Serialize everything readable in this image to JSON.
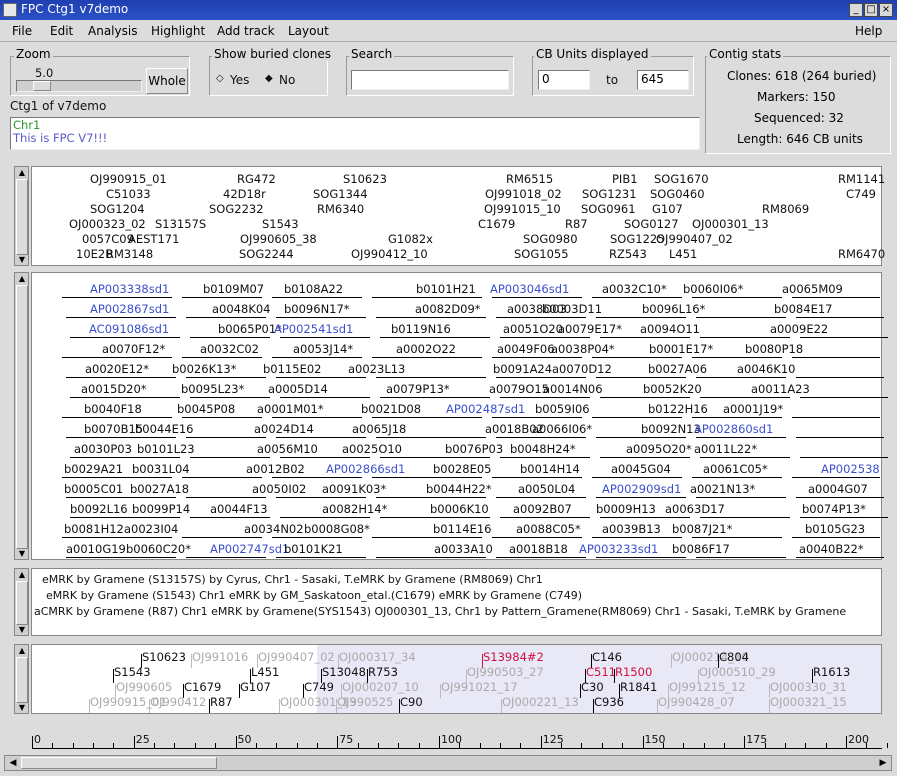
{
  "window": {
    "title": "FPC Ctg1 v7demo"
  },
  "menu": [
    "File",
    "Edit",
    "Analysis",
    "Highlight",
    "Add track",
    "Layout"
  ],
  "help": "Help",
  "zoom": {
    "label": "Zoom",
    "value": "5.0",
    "button": "Whole"
  },
  "buried": {
    "label": "Show buried clones",
    "yes": "Yes",
    "no": "No"
  },
  "search": {
    "label": "Search",
    "value": ""
  },
  "cb": {
    "label": "CB Units displayed",
    "from": "0",
    "to_label": "to",
    "to": "645"
  },
  "stats": {
    "label": "Contig stats",
    "clones": "Clones: 618 (264 buried)",
    "markers": "Markers: 150",
    "sequenced": "Sequenced: 32",
    "length": "Length: 646 CB units"
  },
  "contig": {
    "label": "Ctg1 of v7demo",
    "line1": "Chr1",
    "line2": "This is FPC V7!!!"
  },
  "markers": [
    "OJ990915_01",
    "RG472",
    "S10623",
    "RM6515",
    "PIB1",
    "SOG1670",
    "RM1141",
    "C51033",
    "42D18r",
    "SOG1344",
    "OJ991018_02",
    "SOG1231",
    "SOG0460",
    "C749",
    "SOG1204",
    "SOG2232",
    "RM6340",
    "OJ991015_10",
    "SOG0961",
    "G107",
    "RM8069",
    "OJ000323_02",
    "S13157S",
    "S1543",
    "C1679",
    "R87",
    "SOG0127",
    "OJ000301_13",
    "0057C09",
    "AEST171",
    "OJ990605_38",
    "G1082x",
    "SOG0980",
    "SOG1225",
    "OJ990407_02",
    "10E2B",
    "RM3148",
    "SOG2244",
    "OJ990412_10",
    "SOG1055",
    "RZ543",
    "L451",
    "RM6470"
  ],
  "clones": [
    "AP003338sd1",
    "b0109M07",
    "b0108A22",
    "b0101H21",
    "AP003046sd1",
    "a0032C10*",
    "b0060I06*",
    "a0065M09",
    "AP002867sd1",
    "a0048K04",
    "b0096N17*",
    "a0082D09*",
    "a0038D03",
    "b0003D11",
    "b0096L16*",
    "b0084E17",
    "AC091086sd1",
    "b0065P01*",
    "AP002541sd1",
    "b0119N16",
    "a0051O20",
    "a0079E17*",
    "a0094O11",
    "a0009E22",
    "a0070F12*",
    "a0032C02",
    "a0053J14*",
    "a0002O22",
    "a0049F06",
    "a0038P04*",
    "b0001E17*",
    "b0080P18",
    "a0020E12*",
    "b0026K13*",
    "b0115E02",
    "a0023L13",
    "b0091A24",
    "a0070D12",
    "b0027A06",
    "a0046K10",
    "a0015D20*",
    "b0095L23*",
    "a0005D14",
    "a0079P13*",
    "a0079O15",
    "a0014N06",
    "b0052K20",
    "a0011A23",
    "b0040F18",
    "b0045P08",
    "a0001M01*",
    "b0021D08",
    "AP002487sd1",
    "b0059I06",
    "b0122H16",
    "a0001J19*",
    "b0070B15",
    "b0044E16",
    "a0024D14",
    "a0065J18",
    "a0018B02",
    "a0066I06*",
    "b0092N13",
    "AP002860sd1",
    "a0030P03",
    "b0101L23",
    "a0056M10",
    "a0025O10",
    "b0076P03",
    "b0048H24*",
    "a0095O20*",
    "a0011L22*",
    "b0029A21",
    "b0031L04",
    "a0012B02",
    "AP002866sd1",
    "b0028E05",
    "b0014H14",
    "a0045G04",
    "a0061C05*",
    "AP002538",
    "b0005C01",
    "b0027A18",
    "a0050I02",
    "a0091K03*",
    "b0044H22*",
    "a0050L04",
    "AP002909sd1",
    "a0021N13*",
    "a0004G07",
    "b0092L16",
    "b0099P14",
    "a0044F13",
    "a0082H14*",
    "b0006K10",
    "a0092B07",
    "b0009H13",
    "a0063D17",
    "b0074P13*",
    "b0081H12",
    "a0023I04",
    "a0034N02",
    "b0008G08*",
    "b0114E16",
    "a0088C05*",
    "a0039B13",
    "b0087J21*",
    "b0105G23",
    "a0010G19",
    "b0060C20*",
    "AP002747sd1",
    "b0101K21",
    "a0033A10",
    "a0018B18",
    "AP003233sd1",
    "b0086F17",
    "a0040B22*"
  ],
  "remarks": [
    "eMRK by Gramene (S13157S) by Cyrus, Chr1 - Sasaki, T.eMRK by Gramene (RM8069) Chr1",
    "eMRK by Gramene (S1543) Chr1 eMRK by GM_Saskatoon_etal.(C1679) eMRK by Gramene (C749)",
    "aCMRK by Gramene (R87) Chr1 eMRK by Gramene(SYS1543) OJ000301_13, Chr1 by Pattern_Gramene(RM8069) Chr1 - Sasaki, T.eMRK by Gramene"
  ],
  "track": [
    "S10623",
    "OJ991016",
    "OJ990407_02",
    "OJ000317_34",
    "S13984#2",
    "C146",
    "OJ000214_10",
    "C804",
    "S1543",
    "L451",
    "S13048",
    "R753",
    "OJ990503_27",
    "C511",
    "R1500",
    "OJ000510_29",
    "R1613",
    "OJ990605",
    "C1679",
    "G107",
    "C749",
    "OJ000207_10",
    "OJ991021_17",
    "C30",
    "R1841",
    "OJ991215_12",
    "OJ000330_31",
    "OJ990915_01",
    "OJ990412",
    "R87",
    "OJ000301_13",
    "OJ990525",
    "C90",
    "OJ000221_13",
    "C936",
    "OJ990428_07",
    "OJ000321_15"
  ],
  "ruler": [
    "0",
    "25",
    "50",
    "75",
    "100",
    "125",
    "150",
    "175",
    "200"
  ]
}
